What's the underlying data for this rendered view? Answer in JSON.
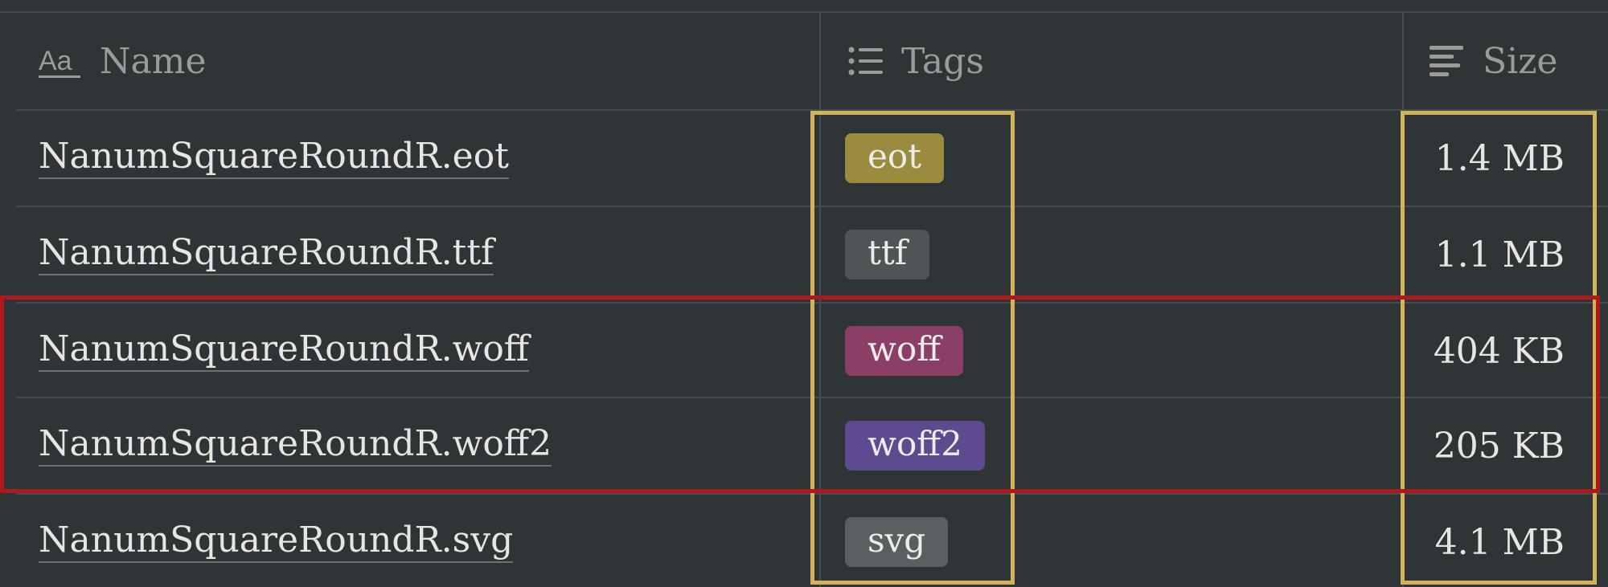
{
  "columns": {
    "name": {
      "label": "Name",
      "icon": "text-property-icon"
    },
    "tags": {
      "label": "Tags",
      "icon": "multi-select-icon"
    },
    "size": {
      "label": "Size",
      "icon": "size-sort-icon"
    }
  },
  "rows": [
    {
      "name": "NanumSquareRoundR.eot",
      "tag": "eot",
      "tag_color": "#9a8c3e",
      "size": "1.4 MB"
    },
    {
      "name": "NanumSquareRoundR.ttf",
      "tag": "ttf",
      "tag_color": "#4f5457",
      "size": "1.1 MB"
    },
    {
      "name": "NanumSquareRoundR.woff",
      "tag": "woff",
      "tag_color": "#8b3f66",
      "size": "404 KB"
    },
    {
      "name": "NanumSquareRoundR.woff2",
      "tag": "woff2",
      "tag_color": "#5e4a8e",
      "size": "205 KB"
    },
    {
      "name": "NanumSquareRoundR.svg",
      "tag": "svg",
      "tag_color": "#5a5f62",
      "size": "4.1 MB"
    }
  ],
  "highlight_colors": {
    "column_boxes": "#d2b25a",
    "row_box": "#b0191c"
  }
}
